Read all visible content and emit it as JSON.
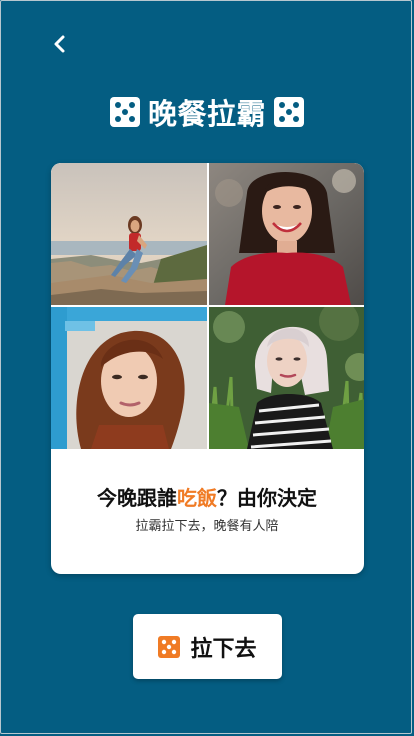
{
  "nav": {
    "back_icon": "chevron-left-icon"
  },
  "header": {
    "title": "晚餐拉霸",
    "left_icon": "dice-five-icon",
    "right_icon": "dice-five-icon"
  },
  "card": {
    "photos": [
      {
        "name": "photo-woman-seaside-rocks"
      },
      {
        "name": "photo-woman-smiling-red-sweater"
      },
      {
        "name": "photo-woman-red-hair"
      },
      {
        "name": "photo-woman-silver-hair"
      }
    ],
    "headline_before": "今晚跟誰",
    "headline_highlight": "吃飯",
    "headline_after": "？由你決定",
    "subtitle": "拉霸拉下去，晚餐有人陪"
  },
  "cta": {
    "label": "拉下去",
    "icon": "dice-five-icon"
  },
  "colors": {
    "background": "#045d82",
    "card": "#ffffff",
    "accent": "#f07b25",
    "text": "#111111"
  }
}
